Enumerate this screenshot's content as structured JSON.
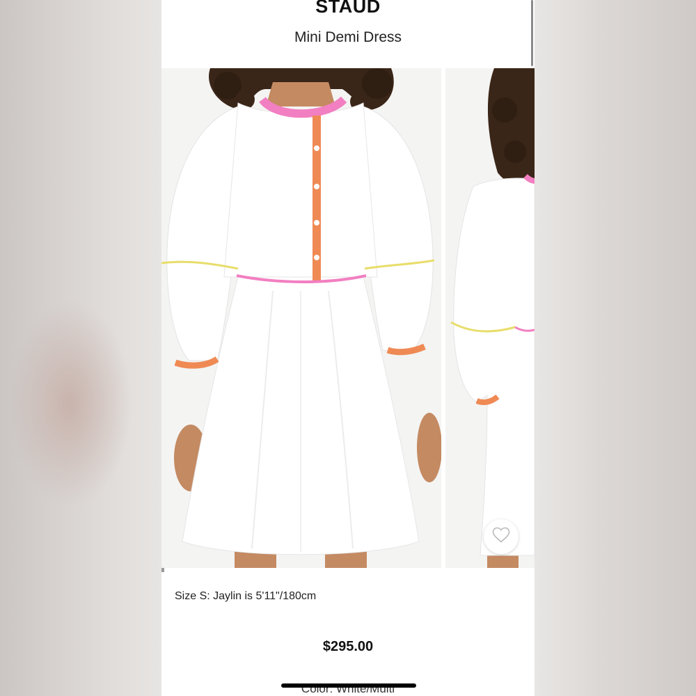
{
  "product": {
    "brand": "STAUD",
    "title": "Mini Demi Dress",
    "model_info": "Size S: Jaylin is 5'11\"/180cm",
    "price": "$295.00",
    "color": "Color: White/Multi"
  },
  "colors": {
    "accent_pink": "#f27fc1",
    "accent_orange": "#ef8a55",
    "accent_yellow": "#e8dd6a",
    "dress_white": "#ffffff"
  },
  "icons": {
    "wishlist": "heart-outline-icon"
  }
}
